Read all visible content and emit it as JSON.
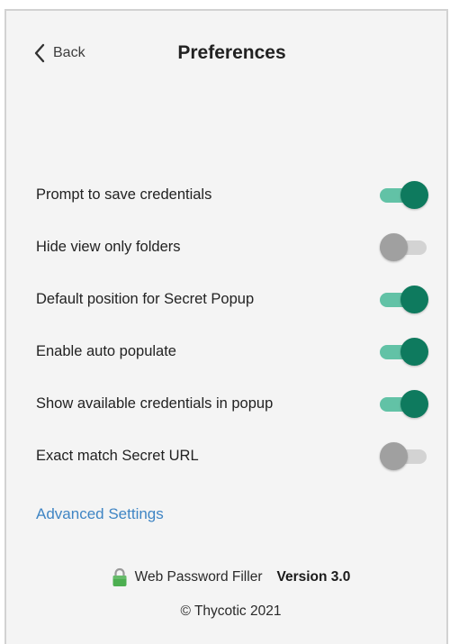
{
  "header": {
    "back_label": "Back",
    "title": "Preferences"
  },
  "settings": [
    {
      "label": "Prompt to save credentials",
      "enabled": true
    },
    {
      "label": "Hide view only folders",
      "enabled": false
    },
    {
      "label": "Default position for Secret Popup",
      "enabled": true
    },
    {
      "label": "Enable auto populate",
      "enabled": true
    },
    {
      "label": "Show available credentials in popup",
      "enabled": true
    },
    {
      "label": "Exact match Secret URL",
      "enabled": false
    }
  ],
  "advanced_settings_label": "Advanced Settings",
  "footer": {
    "app_name": "Web Password Filler",
    "version": "Version 3.0",
    "copyright": "© Thycotic 2021",
    "icon": "lock-icon"
  },
  "colors": {
    "toggle_on_track": "#62c2a6",
    "toggle_on_knob": "#0e7a5e",
    "toggle_off_track": "#d3d3d3",
    "toggle_off_knob": "#a0a0a0",
    "link": "#3f85c4",
    "lock_green": "#4caf50"
  }
}
